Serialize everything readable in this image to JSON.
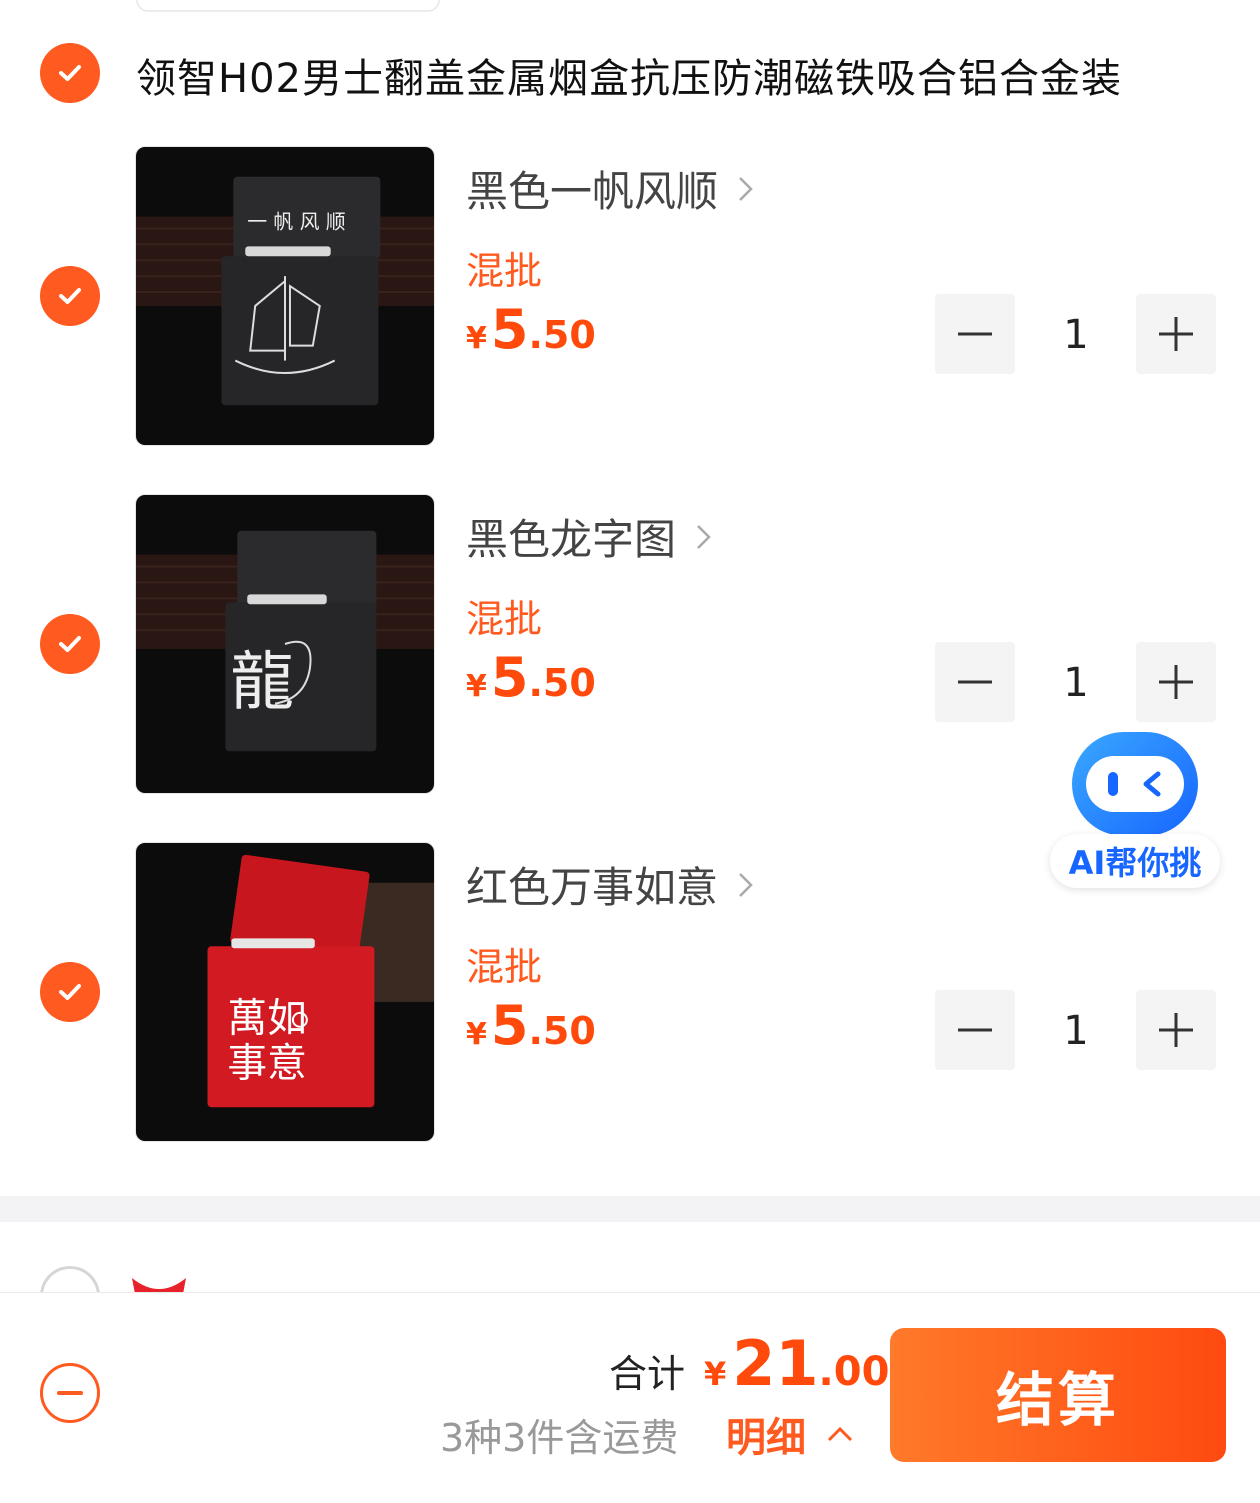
{
  "product": {
    "title": "领智H02男士翻盖金属烟盒抗压防潮磁铁吸合铝合金装",
    "checked": true
  },
  "items": [
    {
      "variant": "黑色一帆风顺",
      "tag": "混批",
      "currency": "¥",
      "price_int": "5",
      "price_dec": ".50",
      "qty": "1",
      "image": "black-case-sailboat",
      "checked": true
    },
    {
      "variant": "黑色龙字图",
      "tag": "混批",
      "currency": "¥",
      "price_int": "5",
      "price_dec": ".50",
      "qty": "1",
      "image": "black-case-dragon",
      "checked": true
    },
    {
      "variant": "红色万事如意",
      "tag": "混批",
      "currency": "¥",
      "price_int": "5",
      "price_dec": ".50",
      "qty": "1",
      "image": "red-case-calligraphy",
      "checked": true
    }
  ],
  "ai_helper": {
    "label": "AI帮你挑"
  },
  "footer": {
    "total_label": "合计",
    "currency": "¥",
    "total_int": "21",
    "total_dec": ".00",
    "summary": "3种3件含运费",
    "detail_label": "明细",
    "checkout_label": "结算"
  },
  "colors": {
    "accent": "#ff5a1f",
    "price": "#ff4a0c",
    "ai_blue": "#1766ff"
  }
}
